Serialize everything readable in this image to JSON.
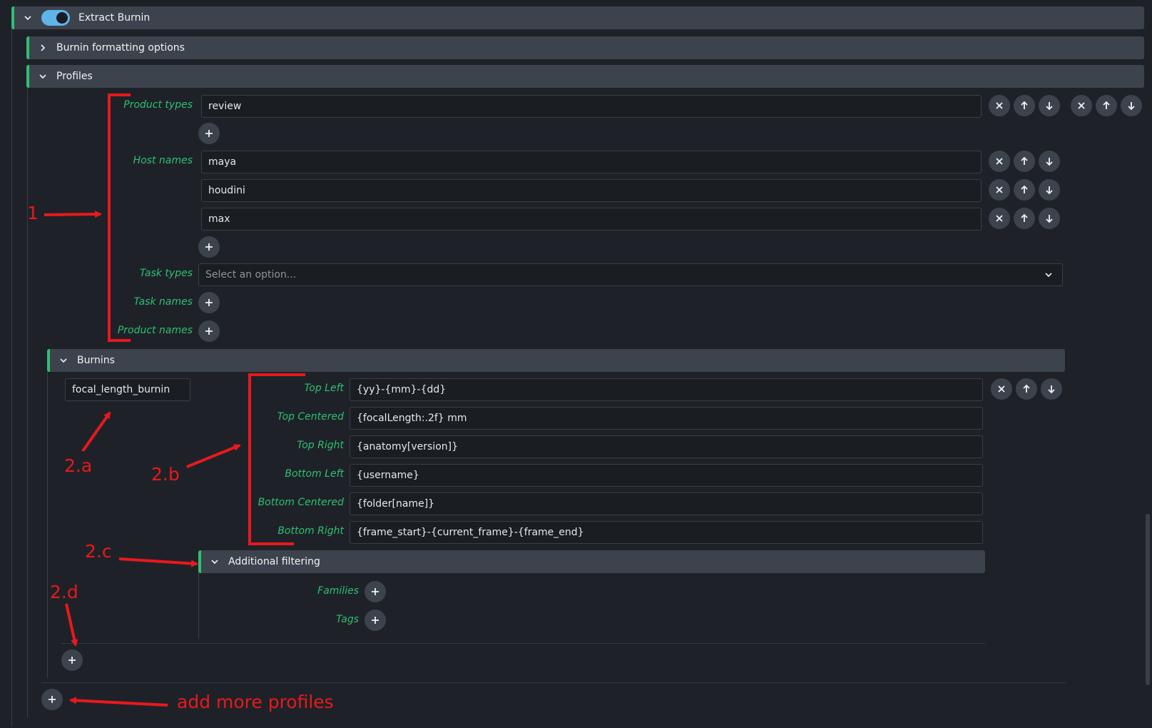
{
  "extract_burnin": {
    "title": "Extract Burnin",
    "enabled": true
  },
  "burnin_formatting": {
    "title": "Burnin formatting options"
  },
  "profiles": {
    "title": "Profiles",
    "product_types": {
      "label": "Product types",
      "values": [
        "review"
      ]
    },
    "host_names": {
      "label": "Host names",
      "values": [
        "maya",
        "houdini",
        "max"
      ]
    },
    "task_types": {
      "label": "Task types",
      "placeholder": "Select an option..."
    },
    "task_names": {
      "label": "Task names"
    },
    "product_names": {
      "label": "Product names"
    }
  },
  "burnins": {
    "title": "Burnins",
    "key": "focal_length_burnin",
    "fields": [
      {
        "label": "Top Left",
        "value": "{yy}-{mm}-{dd}"
      },
      {
        "label": "Top Centered",
        "value": "{focalLength:.2f} mm"
      },
      {
        "label": "Top Right",
        "value": "{anatomy[version]}"
      },
      {
        "label": "Bottom Left",
        "value": "{username}"
      },
      {
        "label": "Bottom Centered",
        "value": "{folder[name]}"
      },
      {
        "label": "Bottom Right",
        "value": "{frame_start}-{current_frame}-{frame_end}"
      }
    ],
    "additional_filtering": {
      "title": "Additional filtering",
      "families_label": "Families",
      "tags_label": "Tags"
    }
  },
  "annotations": {
    "a1": "1",
    "a2a": "2.a",
    "a2b": "2.b",
    "a2c": "2.c",
    "a2d": "2.d",
    "add_more": "add more profiles"
  },
  "colors": {
    "accent_green": "#2fbf71",
    "annotation_red": "#e8191c",
    "toggle_blue": "#5fb4e8"
  }
}
